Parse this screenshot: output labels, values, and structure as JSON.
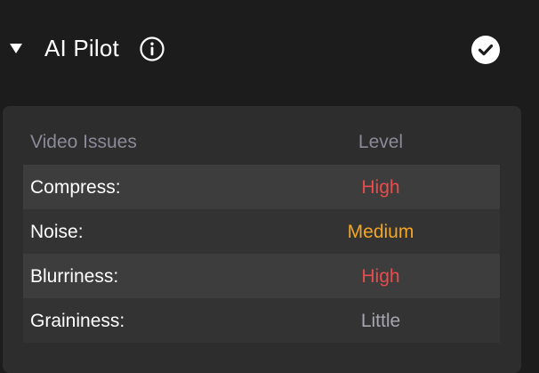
{
  "header": {
    "title": "AI Pilot",
    "info_icon": "info-icon",
    "status_icon": "check-circle-icon"
  },
  "table": {
    "columns": [
      "Video Issues",
      "Level"
    ],
    "rows": [
      {
        "issue": "Compress:",
        "level": "High",
        "color": "#e84c4c"
      },
      {
        "issue": "Noise:",
        "level": "Medium",
        "color": "#f2a623"
      },
      {
        "issue": "Blurriness:",
        "level": "High",
        "color": "#e84c4c"
      },
      {
        "issue": "Graininess:",
        "level": "Little",
        "color": "#a6a6b0"
      }
    ]
  }
}
